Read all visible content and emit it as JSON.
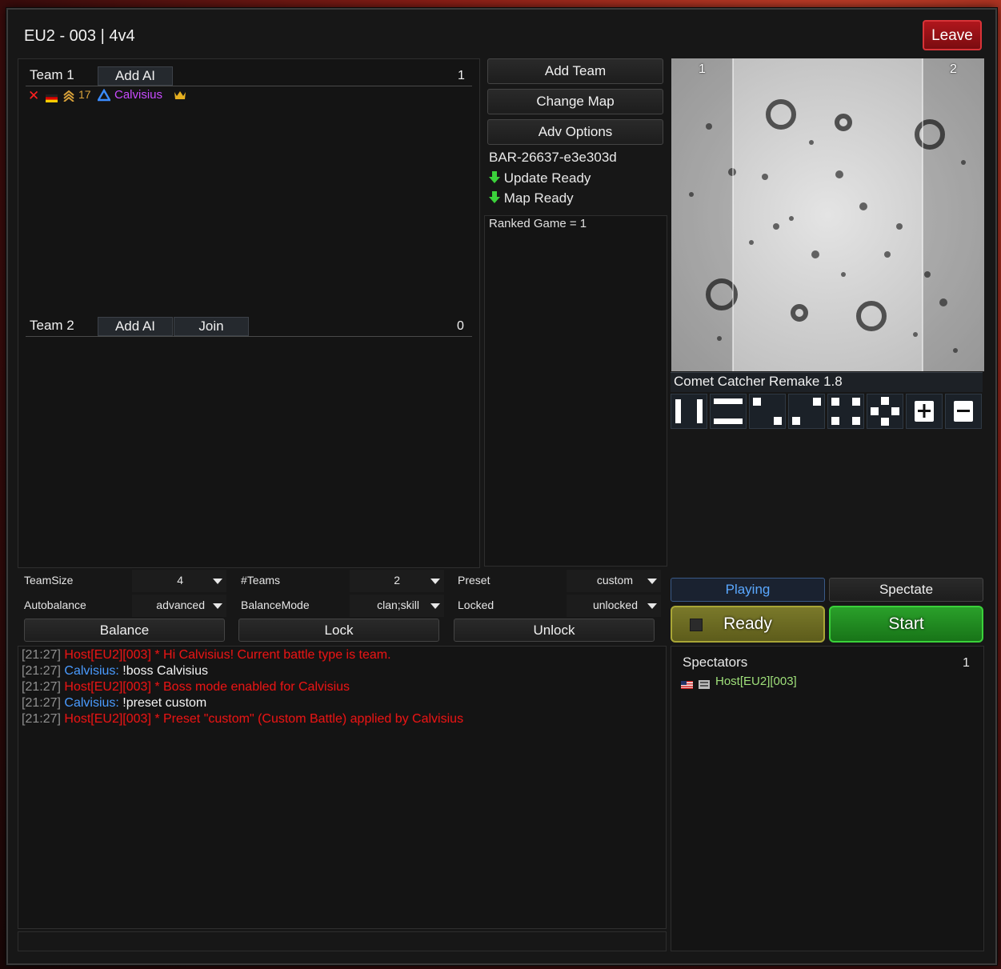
{
  "window": {
    "title": "EU2 - 003 | 4v4",
    "leave_label": "Leave"
  },
  "teams": [
    {
      "label": "Team 1",
      "add_ai_label": "Add AI",
      "count": "1",
      "players": [
        {
          "rank": "17",
          "name": "Calvisius",
          "name_color": "#c84bff"
        }
      ]
    },
    {
      "label": "Team 2",
      "add_ai_label": "Add AI",
      "join_label": "Join",
      "count": "0"
    }
  ],
  "actions": {
    "add_team": "Add Team",
    "change_map": "Change Map",
    "adv_options": "Adv Options"
  },
  "info": {
    "engine": "BAR-26637-e3e303d",
    "update_status": "Update Ready",
    "map_status": "Map Ready"
  },
  "modoptions": {
    "text": "Ranked Game = 1"
  },
  "map": {
    "name": "Comet Catcher Remake 1.8",
    "start_box_1": "1",
    "start_box_2": "2"
  },
  "options": {
    "teamsize": {
      "label": "TeamSize",
      "value": "4"
    },
    "teams": {
      "label": "#Teams",
      "value": "2"
    },
    "preset": {
      "label": "Preset",
      "value": "custom"
    },
    "autobalance": {
      "label": "Autobalance",
      "value": "advanced"
    },
    "balancemode": {
      "label": "BalanceMode",
      "value": "clan;skill"
    },
    "locked": {
      "label": "Locked",
      "value": "unlocked"
    }
  },
  "buttons": {
    "balance": "Balance",
    "lock": "Lock",
    "unlock": "Unlock",
    "playing": "Playing",
    "spectate": "Spectate",
    "ready": "Ready",
    "start": "Start"
  },
  "chat": [
    {
      "time": "[21:27]",
      "speaker": "Host[EU2][003]",
      "text": " * Hi Calvisius! Current battle type is team."
    },
    {
      "time": "[21:27]",
      "speaker": "Calvisius:",
      "text": " !boss Calvisius"
    },
    {
      "time": "[21:27]",
      "speaker": "Host[EU2][003]",
      "text": " * Boss mode enabled for Calvisius"
    },
    {
      "time": "[21:27]",
      "speaker": "Calvisius:",
      "text": " !preset custom"
    },
    {
      "time": "[21:27]",
      "speaker": "Host[EU2][003]",
      "text": " * Preset \"custom\" (Custom Battle) applied by Calvisius"
    }
  ],
  "spectators": {
    "label": "Spectators",
    "count": "1",
    "list": [
      {
        "name": "Host[EU2][003]"
      }
    ]
  },
  "colors": {
    "ready_bg": "#6b6a1f",
    "start_bg": "#1f8a1f",
    "playing_text": "#5aa8ff",
    "spectator_name": "#9fe07a"
  }
}
